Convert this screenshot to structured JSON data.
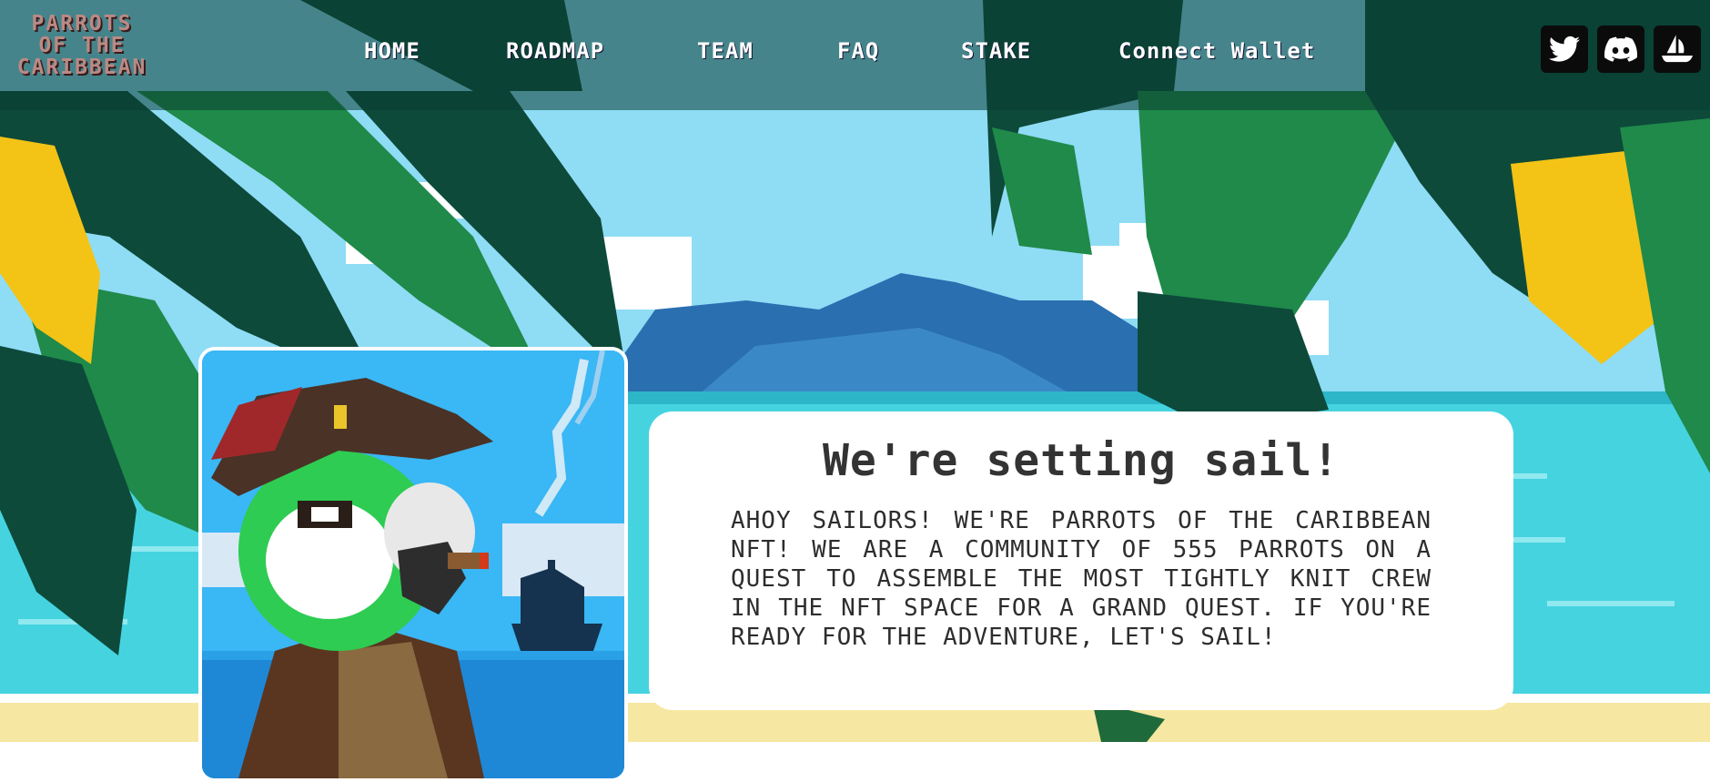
{
  "brand": {
    "logo_lines": [
      "PARROTS",
      "OF THE",
      "CARIBBEAN"
    ]
  },
  "nav": {
    "home": "HOME",
    "roadmap": "ROADMAP",
    "team": "TEAM",
    "faq": "FAQ",
    "stake": "STAKE",
    "connect_wallet": "Connect Wallet"
  },
  "social": [
    {
      "icon": "twitter-icon"
    },
    {
      "icon": "discord-icon"
    },
    {
      "icon": "opensea-ship-icon"
    }
  ],
  "hero": {
    "title": "We're setting sail!",
    "body": "Ahoy sailors! We're Parrots of the Caribbean NFT! We are a community of 555 parrots on a quest to assemble the most tightly knit crew in the NFT space for a grand quest. If you're ready for the adventure, let's sail!"
  },
  "colors": {
    "sky": "#8fdcf5",
    "sea": "#46d3e0",
    "sand": "#f6e7a2",
    "leaf_dark": "#0d4a3a",
    "leaf_mid": "#1f8a4a",
    "leaf_light": "#36b54a",
    "banana": "#f3c316",
    "mountain": "#2a6fb0"
  }
}
